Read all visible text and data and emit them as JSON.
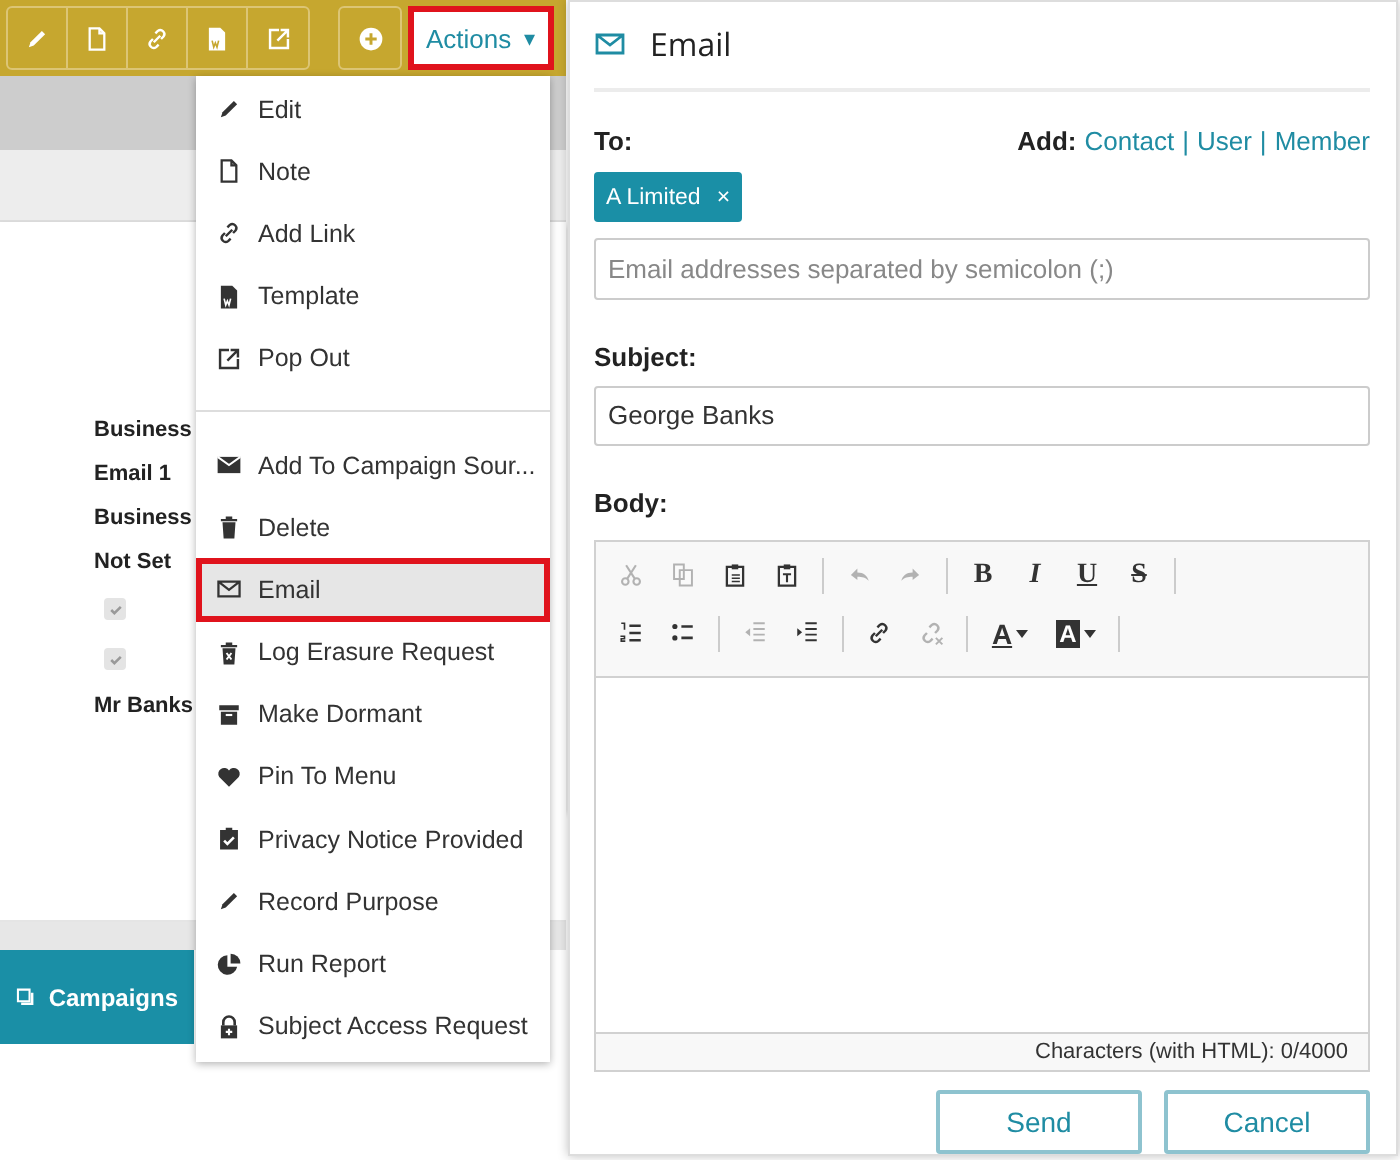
{
  "toolbar": {
    "buttons": [
      {
        "kind": "pencil"
      },
      {
        "kind": "note"
      },
      {
        "kind": "link"
      },
      {
        "kind": "template"
      },
      {
        "kind": "popout"
      },
      {
        "kind": "plus"
      }
    ],
    "actions": {
      "label": "Actions",
      "caret": "▾",
      "highlighted": true
    }
  },
  "record": {
    "fields": [
      {
        "kind": "text",
        "label": "Business"
      },
      {
        "kind": "text",
        "label": "Email 1"
      },
      {
        "kind": "text",
        "label": "Business"
      },
      {
        "kind": "text",
        "label": "Not Set"
      },
      {
        "kind": "checkbox",
        "checked": true
      },
      {
        "kind": "checkbox",
        "checked": true
      },
      {
        "kind": "text",
        "label": "Mr Banks"
      }
    ]
  },
  "bottom_tab": {
    "label": "Campaigns"
  },
  "menu": {
    "items": [
      {
        "kind": "pencil",
        "label": "Edit",
        "selected": false
      },
      {
        "kind": "note",
        "label": "Note",
        "selected": false
      },
      {
        "kind": "link",
        "label": "Add Link",
        "selected": false
      },
      {
        "kind": "template",
        "label": "Template",
        "selected": false
      },
      {
        "kind": "popout",
        "label": "Pop Out",
        "selected": false
      },
      {
        "kind": "divider"
      },
      {
        "kind": "envelope-solid",
        "label": "Add To Campaign Sour...",
        "selected": false
      },
      {
        "kind": "trash",
        "label": "Delete",
        "selected": false
      },
      {
        "kind": "envelope",
        "label": "Email",
        "selected": true
      },
      {
        "kind": "erase",
        "label": "Log Erasure Request",
        "selected": false
      },
      {
        "kind": "archive",
        "label": "Make Dormant",
        "selected": false
      },
      {
        "kind": "heart",
        "label": "Pin To Menu",
        "selected": false
      },
      {
        "kind": "clipboard",
        "label": "Privacy Notice Provided",
        "selected": false
      },
      {
        "kind": "pencil",
        "label": "Record Purpose",
        "selected": false
      },
      {
        "kind": "pie",
        "label": "Run Report",
        "selected": false
      },
      {
        "kind": "lock",
        "label": "Subject Access Request",
        "selected": false
      }
    ]
  },
  "dialog": {
    "title": "Email",
    "to_label": "To:",
    "add_label": "Add:",
    "add_links": [
      "Contact",
      "User",
      "Member"
    ],
    "link_separator": "|",
    "recipients": [
      {
        "label": "A Limited",
        "remove": "×"
      }
    ],
    "address_field": {
      "placeholder": "Email addresses separated by semicolon (;)"
    },
    "subject_label": "Subject:",
    "subject_field": {
      "value": "George Banks"
    },
    "body_label": "Body:",
    "editor_toolbar": [
      [
        {
          "kind": "cut",
          "disabled": true
        },
        {
          "kind": "copy",
          "disabled": true
        },
        {
          "kind": "paste",
          "disabled": false
        },
        {
          "kind": "paste-text",
          "disabled": false
        },
        {
          "kind": "separator"
        },
        {
          "kind": "undo",
          "disabled": true
        },
        {
          "kind": "redo",
          "disabled": true
        },
        {
          "kind": "separator"
        },
        {
          "kind": "bold",
          "label": "B",
          "disabled": false
        },
        {
          "kind": "italic",
          "label": "I",
          "disabled": false
        },
        {
          "kind": "underline",
          "label": "U",
          "disabled": false
        },
        {
          "kind": "strike",
          "label": "S",
          "disabled": false
        },
        {
          "kind": "separator"
        }
      ],
      [
        {
          "kind": "numbered-list",
          "disabled": false
        },
        {
          "kind": "bulleted-list",
          "disabled": false
        },
        {
          "kind": "separator"
        },
        {
          "kind": "outdent",
          "disabled": true
        },
        {
          "kind": "indent",
          "disabled": false
        },
        {
          "kind": "separator"
        },
        {
          "kind": "link",
          "disabled": false
        },
        {
          "kind": "unlink",
          "disabled": true
        },
        {
          "kind": "separator"
        },
        {
          "kind": "text-color",
          "label": "A",
          "disabled": false
        },
        {
          "kind": "bg-color",
          "label": "A",
          "disabled": false
        },
        {
          "kind": "separator"
        }
      ]
    ],
    "counter": "Characters (with HTML): 0/4000",
    "buttons": [
      "Send",
      "Cancel"
    ]
  }
}
